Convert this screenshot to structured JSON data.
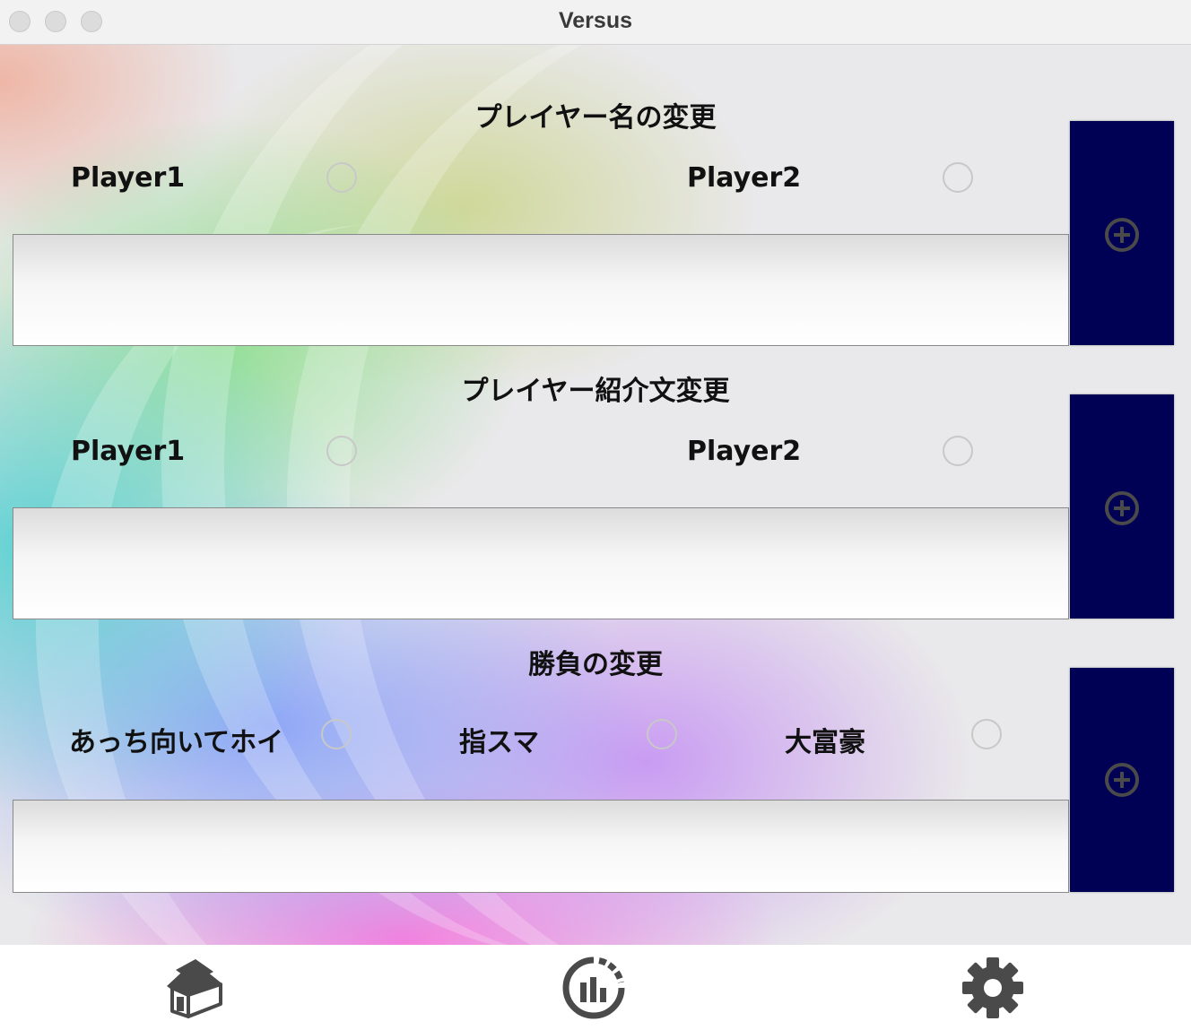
{
  "window": {
    "title": "Versus"
  },
  "sections": [
    {
      "heading": "プレイヤー名の変更",
      "options": [
        "Player1",
        "Player2"
      ],
      "input_value": ""
    },
    {
      "heading": "プレイヤー紹介文変更",
      "options": [
        "Player1",
        "Player2"
      ],
      "input_value": ""
    },
    {
      "heading": "勝負の変更",
      "options": [
        "あっち向いてホイ",
        "指スマ",
        "大富豪"
      ],
      "input_value": ""
    }
  ],
  "icons": {
    "add": "plus-circle-icon",
    "tabs": [
      "home-icon",
      "chart-icon",
      "gear-icon"
    ]
  },
  "colors": {
    "add_button": "#000055",
    "icon_gray": "#4a4a4a"
  }
}
